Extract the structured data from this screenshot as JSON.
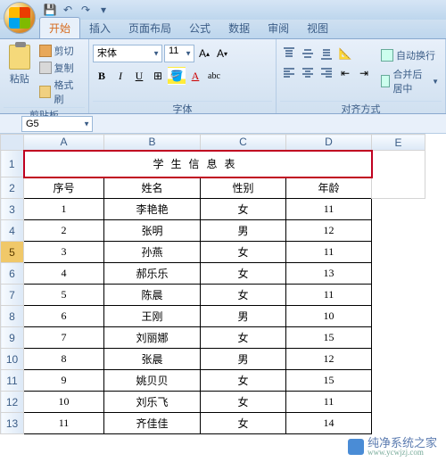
{
  "qat": {
    "save": "💾",
    "undo": "↶",
    "redo": "↷"
  },
  "tabs": [
    "开始",
    "插入",
    "页面布局",
    "公式",
    "数据",
    "审阅",
    "视图"
  ],
  "active_tab": 0,
  "clipboard": {
    "paste": "粘贴",
    "cut": "剪切",
    "copy": "复制",
    "format_painter": "格式刷",
    "group_label": "剪贴板"
  },
  "font": {
    "name": "宋体",
    "size": "11",
    "group_label": "字体",
    "bold": "B",
    "italic": "I",
    "underline": "U"
  },
  "align": {
    "group_label": "对齐方式",
    "wrap_text": "自动换行",
    "merge_center": "合并后居中"
  },
  "namebox": "G5",
  "columns": [
    "A",
    "B",
    "C",
    "D",
    "E"
  ],
  "sheet_title": "学生信息表",
  "headers": [
    "序号",
    "姓名",
    "性别",
    "年龄"
  ],
  "rows": [
    {
      "n": "1",
      "name": "李艳艳",
      "sex": "女",
      "age": "11"
    },
    {
      "n": "2",
      "name": "张明",
      "sex": "男",
      "age": "12"
    },
    {
      "n": "3",
      "name": "孙燕",
      "sex": "女",
      "age": "11"
    },
    {
      "n": "4",
      "name": "郝乐乐",
      "sex": "女",
      "age": "13"
    },
    {
      "n": "5",
      "name": "陈晨",
      "sex": "女",
      "age": "11"
    },
    {
      "n": "6",
      "name": "王刚",
      "sex": "男",
      "age": "10"
    },
    {
      "n": "7",
      "name": "刘丽娜",
      "sex": "女",
      "age": "15"
    },
    {
      "n": "8",
      "name": "张晨",
      "sex": "男",
      "age": "12"
    },
    {
      "n": "9",
      "name": "姚贝贝",
      "sex": "女",
      "age": "15"
    },
    {
      "n": "10",
      "name": "刘乐飞",
      "sex": "女",
      "age": "11"
    },
    {
      "n": "11",
      "name": "齐佳佳",
      "sex": "女",
      "age": "14"
    }
  ],
  "watermark": {
    "text": "纯净系统之家",
    "url": "www.ycwjzj.com"
  }
}
